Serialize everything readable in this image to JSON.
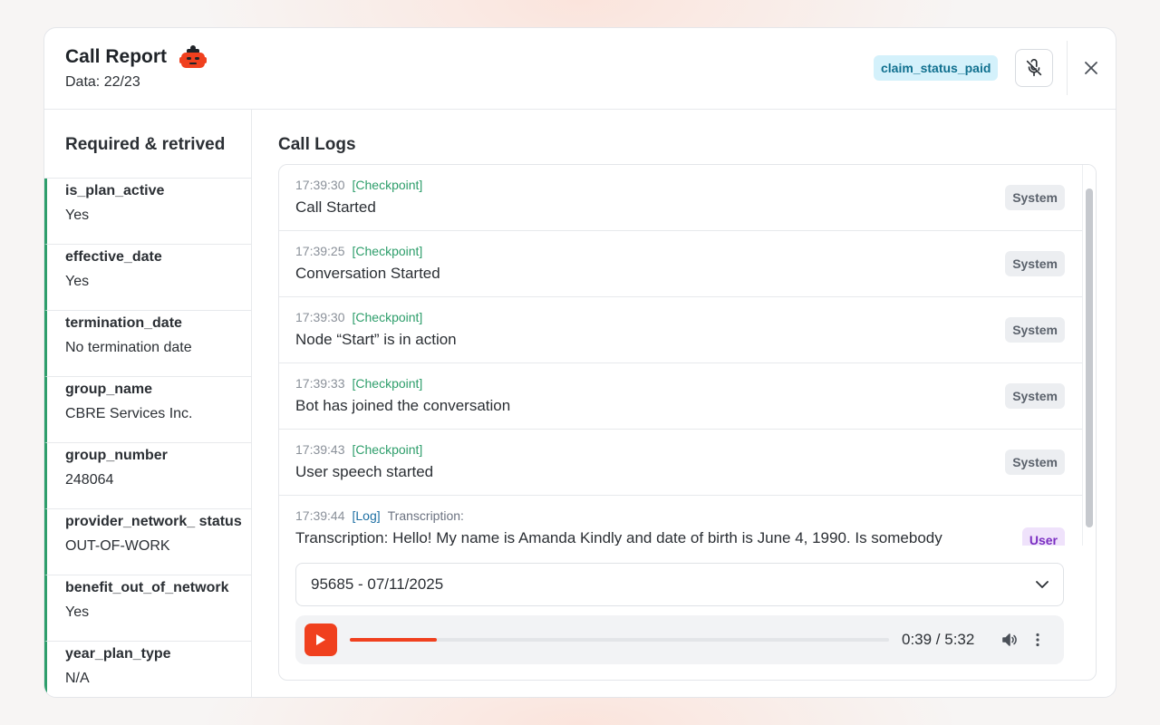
{
  "header": {
    "title": "Call Report",
    "subtitle": "Data: 22/23",
    "status_badge": "claim_status_paid",
    "bot_icon": "robot-icon",
    "mic_icon": "mic-off-icon",
    "close_icon": "close-icon"
  },
  "sidebar": {
    "title": "Required & retrived",
    "fields": [
      {
        "name": "is_plan_active",
        "value": "Yes"
      },
      {
        "name": "effective_date",
        "value": "Yes"
      },
      {
        "name": "termination_date",
        "value": "No termination date"
      },
      {
        "name": "group_name",
        "value": "CBRE Services Inc."
      },
      {
        "name": "group_number",
        "value": "248064"
      },
      {
        "name": "provider_network_ status",
        "value": "OUT-OF-WORK"
      },
      {
        "name": "benefit_out_of_network",
        "value": "Yes"
      },
      {
        "name": "year_plan_type",
        "value": "N/A"
      }
    ]
  },
  "logs": {
    "title": "Call Logs",
    "entries": [
      {
        "time": "17:39:30",
        "tag": "[Checkpoint]",
        "extra": "",
        "text": "Call Started",
        "badge": "System"
      },
      {
        "time": "17:39:25",
        "tag": "[Checkpoint]",
        "extra": "",
        "text": "Conversation Started",
        "badge": "System"
      },
      {
        "time": "17:39:30",
        "tag": "[Checkpoint]",
        "extra": "",
        "text": "Node “Start” is in action",
        "badge": "System"
      },
      {
        "time": "17:39:33",
        "tag": "[Checkpoint]",
        "extra": "",
        "text": "Bot has joined the conversation",
        "badge": "System"
      },
      {
        "time": "17:39:43",
        "tag": "[Checkpoint]",
        "extra": "",
        "text": "User speech started",
        "badge": "System"
      },
      {
        "time": "17:39:44",
        "tag": "[Log]",
        "extra": "Transcription:",
        "text": "Transcription: Hello! My name is Amanda Kindly and date of birth is June 4, 1990. Is somebody",
        "badge": "User"
      }
    ]
  },
  "recording": {
    "selected": "95685 - 07/11/2025"
  },
  "player": {
    "time": "0:39 / 5:32",
    "progress": 0.161
  },
  "colors": {
    "accent": "#f0401e",
    "checkpoint": "#2e9e6b",
    "log_tag": "#1d6fa3",
    "status_badge_bg": "#d4f1fb",
    "user_badge_bg": "#efe2fb"
  }
}
